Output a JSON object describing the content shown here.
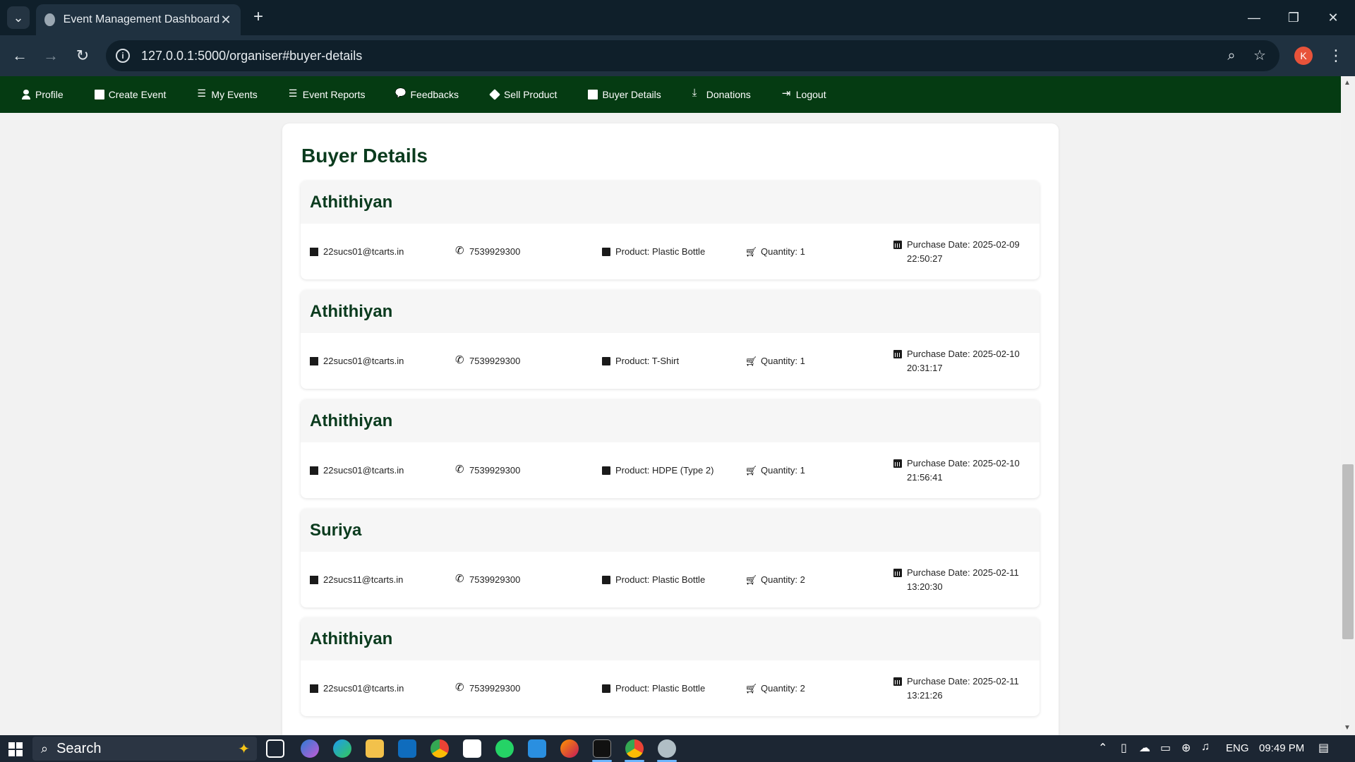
{
  "browser": {
    "tab_title": "Event Management Dashboard",
    "tab_close": "✕",
    "new_tab": "+",
    "url": "127.0.0.1:5000/organiser#buyer-details",
    "profile_initial": "K",
    "minimize": "—",
    "restore": "❐",
    "close": "✕",
    "back": "←",
    "forward": "→",
    "reload": "↻",
    "zoom_icon": "⌕",
    "star_icon": "☆",
    "menu_icon": "⋮",
    "dropdown_icon": "⌄"
  },
  "nav": {
    "items": [
      {
        "label": "Profile",
        "icon": "user-icon"
      },
      {
        "label": "Create Event",
        "icon": "calendar-plus-icon"
      },
      {
        "label": "My Events",
        "icon": "list-icon"
      },
      {
        "label": "Event Reports",
        "icon": "list-icon"
      },
      {
        "label": "Feedbacks",
        "icon": "comments-icon"
      },
      {
        "label": "Sell Product",
        "icon": "tag-icon"
      },
      {
        "label": "Buyer Details",
        "icon": "calendar-icon"
      },
      {
        "label": "Donations",
        "icon": "donate-icon"
      },
      {
        "label": "Logout",
        "icon": "sign-out-icon"
      }
    ],
    "bg_color": "#053b12"
  },
  "page": {
    "title": "Buyer Details",
    "buyers": [
      {
        "name": "Athithiyan",
        "email": "22sucs01@tcarts.in",
        "phone": "7539929300",
        "product": "Product: Plastic Bottle",
        "quantity": "Quantity: 1",
        "purchase_date": "Purchase Date: 2025-02-09 22:50:27"
      },
      {
        "name": "Athithiyan",
        "email": "22sucs01@tcarts.in",
        "phone": "7539929300",
        "product": "Product: T-Shirt",
        "quantity": "Quantity: 1",
        "purchase_date": "Purchase Date: 2025-02-10 20:31:17"
      },
      {
        "name": "Athithiyan",
        "email": "22sucs01@tcarts.in",
        "phone": "7539929300",
        "product": "Product: HDPE (Type 2)",
        "quantity": "Quantity: 1",
        "purchase_date": "Purchase Date: 2025-02-10 21:56:41"
      },
      {
        "name": "Suriya",
        "email": "22sucs11@tcarts.in",
        "phone": "7539929300",
        "product": "Product: Plastic Bottle",
        "quantity": "Quantity: 2",
        "purchase_date": "Purchase Date: 2025-02-11 13:20:30"
      },
      {
        "name": "Athithiyan",
        "email": "22sucs01@tcarts.in",
        "phone": "7539929300",
        "product": "Product: Plastic Bottle",
        "quantity": "Quantity: 2",
        "purchase_date": "Purchase Date: 2025-02-11 13:21:26"
      }
    ]
  },
  "taskbar": {
    "search_placeholder": "Search",
    "language": "ENG",
    "time": "09:49 PM",
    "apps": [
      "task-view",
      "copilot",
      "edge",
      "file-explorer",
      "outlook",
      "chrome",
      "store",
      "whatsapp",
      "vscode",
      "firefox",
      "terminal",
      "chrome-active",
      "app"
    ]
  }
}
